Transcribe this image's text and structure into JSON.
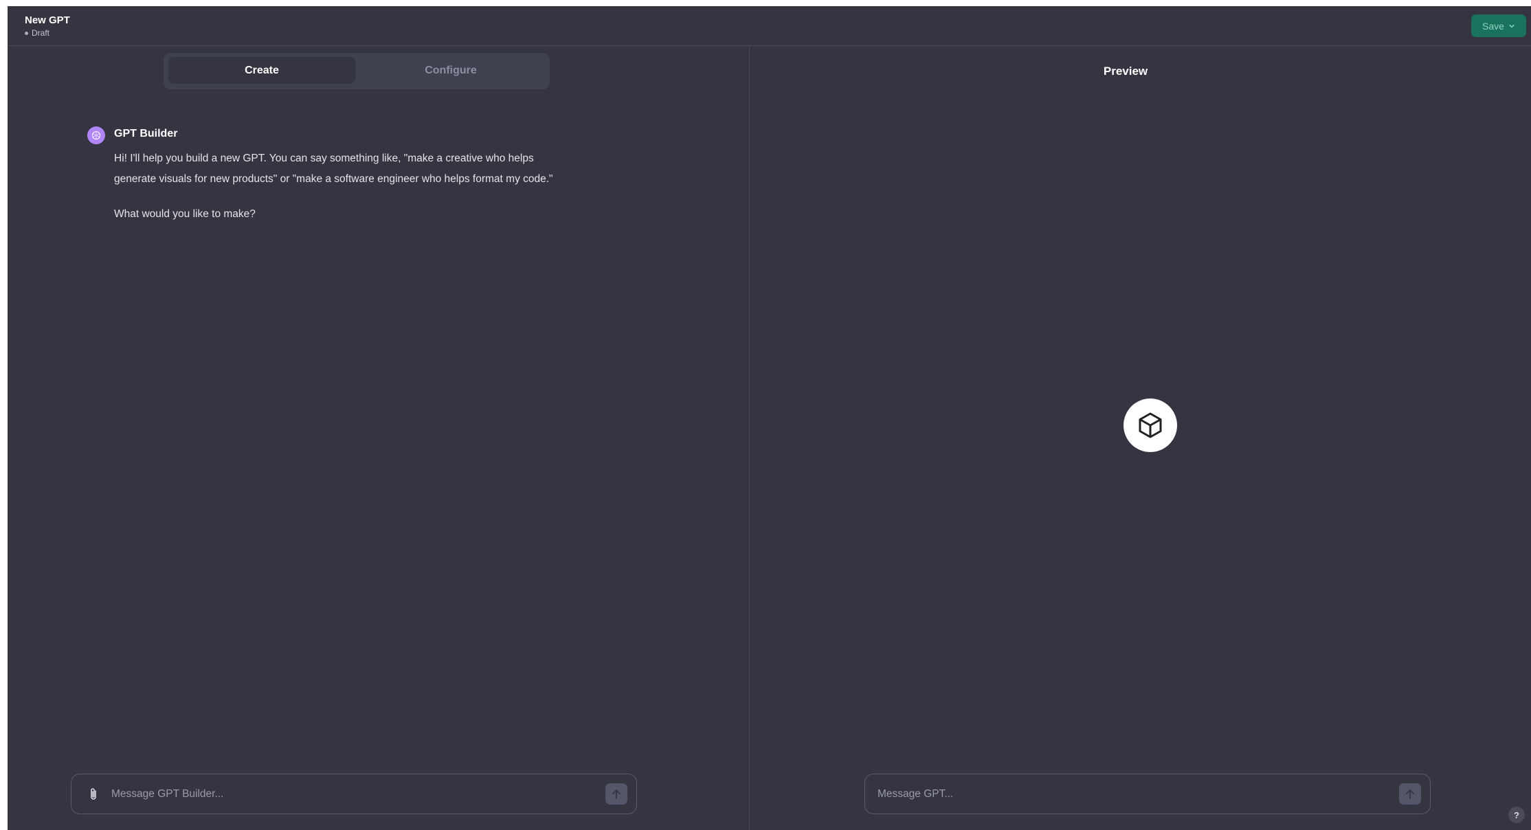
{
  "header": {
    "title": "New GPT",
    "status": "Draft",
    "save_label": "Save"
  },
  "tabs": [
    {
      "label": "Create",
      "active": true
    },
    {
      "label": "Configure",
      "active": false
    }
  ],
  "chat": {
    "sender": "GPT Builder",
    "message_paragraphs": [
      "Hi! I'll help you build a new GPT. You can say something like, \"make a creative who helps generate visuals for new products\" or \"make a software engineer who helps format my code.\"",
      "What would you like to make?"
    ],
    "input_placeholder": "Message GPT Builder..."
  },
  "preview": {
    "title": "Preview",
    "input_placeholder": "Message GPT..."
  },
  "help": {
    "label": "?"
  },
  "colors": {
    "background": "#343541",
    "save_button": "#19735c",
    "avatar": "#b085f5",
    "tab_bar": "#40414f"
  },
  "icons": {
    "attach": "paperclip-icon",
    "send": "arrow-up-icon",
    "preview_logo": "cube-icon",
    "avatar": "gpt-builder-avatar-icon",
    "save_dropdown": "chevron-down-icon"
  }
}
